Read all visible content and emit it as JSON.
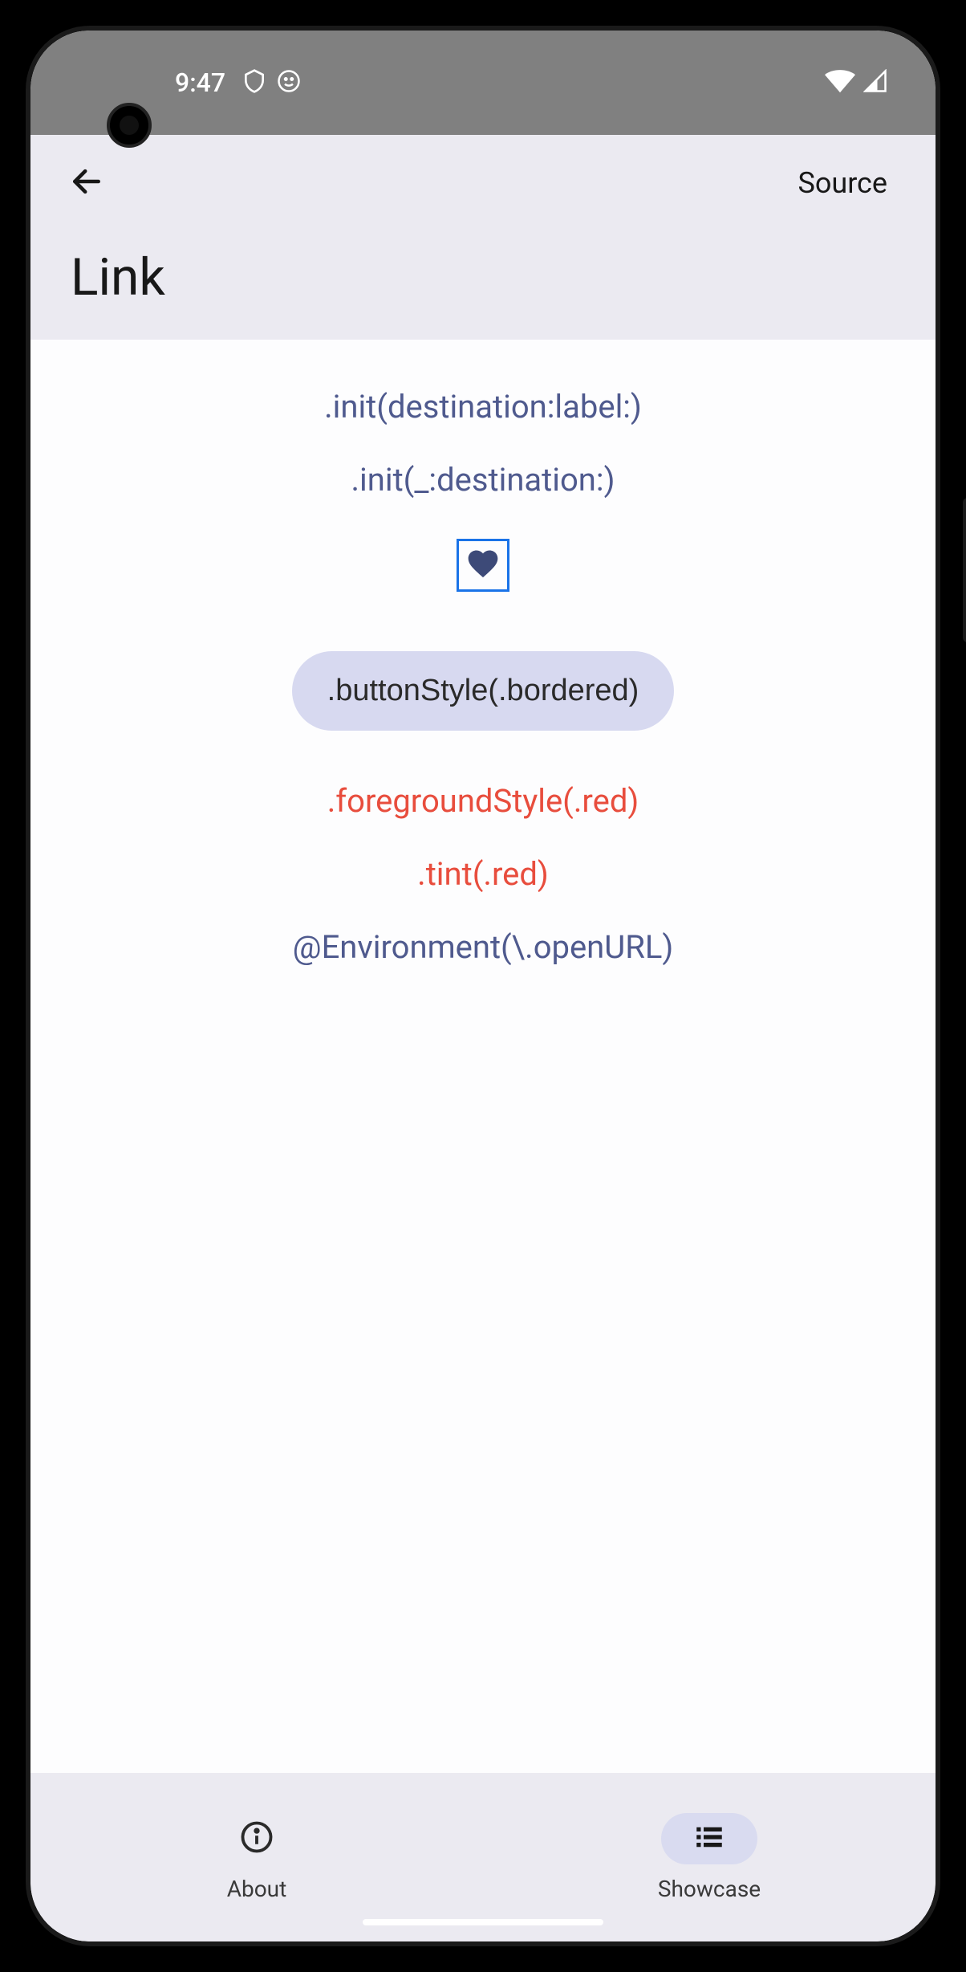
{
  "status": {
    "time": "9:47"
  },
  "header": {
    "source_label": "Source",
    "title": "Link"
  },
  "content": {
    "links": [
      {
        "label": ".init(destination:label:)",
        "color": "blue"
      },
      {
        "label": ".init(_:destination:)",
        "color": "blue"
      }
    ],
    "bordered_button": ".buttonStyle(.bordered)",
    "red_links": [
      {
        "label": ".foregroundStyle(.red)"
      },
      {
        "label": ".tint(.red)"
      }
    ],
    "env_link": "@Environment(\\.openURL)"
  },
  "nav": {
    "about": "About",
    "showcase": "Showcase"
  },
  "icons": {
    "back": "back-arrow",
    "shield": "shield-icon",
    "face": "face-icon",
    "wifi": "wifi-icon",
    "signal": "signal-icon",
    "heart": "heart-icon",
    "info": "info-icon",
    "list": "list-icon"
  }
}
